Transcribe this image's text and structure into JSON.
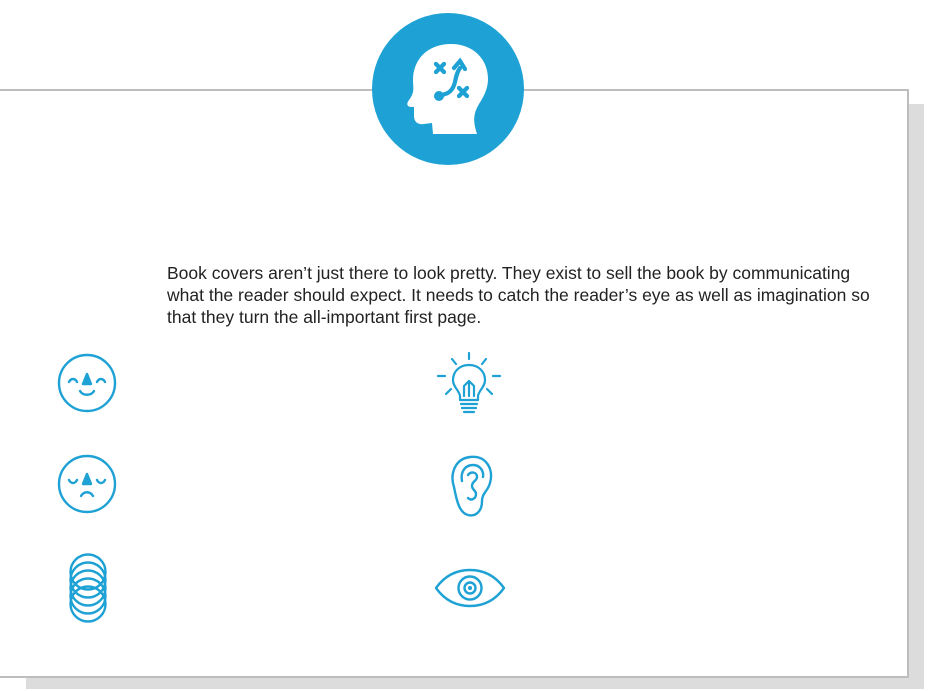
{
  "colors": {
    "accent": "#1ea1d4",
    "text": "#222222",
    "card_border": "#bdbdbd",
    "card_shadow": "#dcdcdc"
  },
  "badge": {
    "icon": "head-strategy-icon"
  },
  "body_text": "Book covers aren’t just there to look pretty. They exist to sell the book by communicating what the reader should expect. It needs to catch the reader’s eye as well as imagination so that they turn the all-important first page.",
  "icons": {
    "left_column": [
      "happy-face-icon",
      "sad-face-icon",
      "stacked-circles-icon"
    ],
    "right_column": [
      "lightbulb-icon",
      "ear-icon",
      "eye-icon"
    ]
  }
}
